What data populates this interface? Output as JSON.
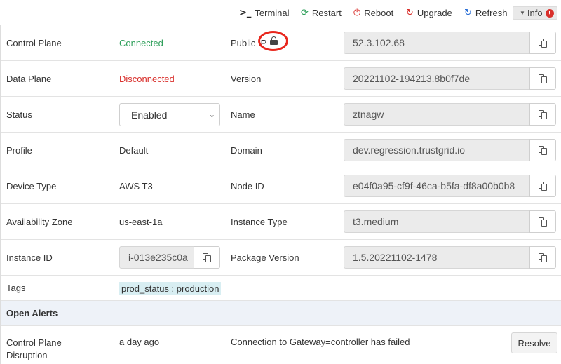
{
  "toolbar": {
    "terminal_label": "Terminal",
    "restart_label": "Restart",
    "reboot_label": "Reboot",
    "upgrade_label": "Upgrade",
    "refresh_label": "Refresh",
    "info_label": "Info",
    "info_badge": "!"
  },
  "details": {
    "control_plane": {
      "label": "Control Plane",
      "value": "Connected"
    },
    "data_plane": {
      "label": "Data Plane",
      "value": "Disconnected"
    },
    "status": {
      "label": "Status",
      "selected": "Enabled"
    },
    "profile": {
      "label": "Profile",
      "value": "Default"
    },
    "device_type": {
      "label": "Device Type",
      "value": "AWS T3"
    },
    "availability_zone": {
      "label": "Availability Zone",
      "value": "us-east-1a"
    },
    "instance_id": {
      "label": "Instance ID",
      "value": "i-013e235c0a"
    },
    "tags": {
      "label": "Tags",
      "value": "prod_status : production"
    },
    "public_ip": {
      "label": "Public IP",
      "value": "52.3.102.68"
    },
    "version": {
      "label": "Version",
      "value": "20221102-194213.8b0f7de"
    },
    "name": {
      "label": "Name",
      "value": "ztnagw"
    },
    "domain": {
      "label": "Domain",
      "value": "dev.regression.trustgrid.io"
    },
    "node_id": {
      "label": "Node ID",
      "value": "e04f0a95-cf9f-46ca-b5fa-df8a00b0b8"
    },
    "instance_type": {
      "label": "Instance Type",
      "value": "t3.medium"
    },
    "package_version": {
      "label": "Package Version",
      "value": "1.5.20221102-1478"
    }
  },
  "alerts": {
    "header": "Open Alerts",
    "items": [
      {
        "title": "Control Plane Disruption",
        "time": "a day ago",
        "message": "Connection to Gateway=controller has failed",
        "action": "Resolve"
      }
    ]
  },
  "colors": {
    "connected": "#2e9f5a",
    "disconnected": "#d9302c",
    "annotation": "#e8261c",
    "section_bg": "#eef2f8",
    "tag_bg": "#d8eef2"
  }
}
